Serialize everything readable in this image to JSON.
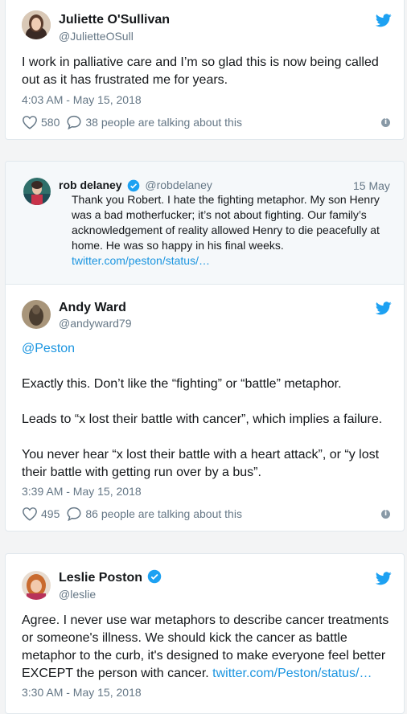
{
  "colors": {
    "link": "#1b95e0",
    "twitter_blue": "#1da1f2",
    "verified": "#1da1f2",
    "secondary": "#657786"
  },
  "tweets": [
    {
      "name": "Juliette O'Sullivan",
      "handle": "@JulietteOSull",
      "text": "I work in palliative care and I’m so glad this is now being called out as it has frustrated me for years.",
      "timestamp": "4:03 AM - May 15, 2018",
      "likes": "580",
      "talking": "38 people are talking about this"
    },
    {
      "quoted": {
        "name": "rob delaney",
        "handle": "@robdelaney",
        "date": "15 May",
        "text": "Thank you Robert. I hate the fighting metaphor. My son Henry was a bad motherfucker; it’s not about fighting. Our family’s acknowledgement of reality allowed Henry to die peacefully at home. He was so happy in his final weeks.",
        "link": "twitter.com/peston/status/…"
      },
      "name": "Andy Ward",
      "handle": "@andyward79",
      "mention": "@Peston",
      "para1": "Exactly this. Don’t like the “fighting” or “battle” metaphor.",
      "para2": "Leads to “x lost their battle with cancer”, which implies a failure.",
      "para3": "You never hear “x lost their battle with a heart attack”, or “y lost their battle with getting run over by a bus”.",
      "timestamp": "3:39 AM - May 15, 2018",
      "likes": "495",
      "talking": "86 people are talking about this"
    },
    {
      "name": "Leslie Poston",
      "handle": "@leslie",
      "text": "Agree. I never use war metaphors to describe cancer treatments or someone's illness. We should kick the cancer as battle metaphor to the curb, it's designed to make everyone feel better EXCEPT the person with cancer. ",
      "link": "twitter.com/Peston/status/…",
      "timestamp": "3:30 AM - May 15, 2018"
    }
  ],
  "icons": {
    "bird": "twitter-bird-icon",
    "heart": "heart-icon",
    "comment": "comment-icon",
    "info": "info-icon",
    "verified": "verified-badge-icon"
  }
}
